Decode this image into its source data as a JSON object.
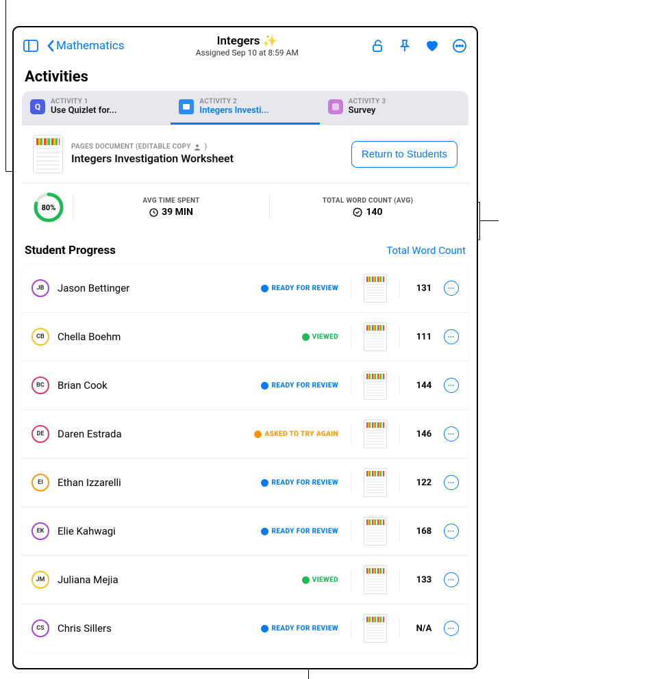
{
  "nav": {
    "back_label": "Mathematics",
    "title": "Integers ✨",
    "subtitle": "Assigned Sep 10 at 8:59 AM"
  },
  "section_title": "Activities",
  "tabs": [
    {
      "eyebrow": "ACTIVITY 1",
      "label": "Use Quizlet for..."
    },
    {
      "eyebrow": "ACTIVITY 2",
      "label": "Integers Investi..."
    },
    {
      "eyebrow": "ACTIVITY 3",
      "label": "Survey"
    }
  ],
  "doc": {
    "eyebrow": "PAGES DOCUMENT (EDITABLE COPY",
    "title": "Integers Investigation Worksheet",
    "return_label": "Return to Students"
  },
  "stats": {
    "percent": "80%",
    "percent_num": 80,
    "time_label": "AVG TIME SPENT",
    "time_value": "39 MIN",
    "words_label": "TOTAL WORD COUNT (AVG)",
    "words_value": "140"
  },
  "progress": {
    "title": "Student Progress",
    "link": "Total Word Count"
  },
  "status_labels": {
    "ready": "READY FOR REVIEW",
    "viewed": "VIEWED",
    "retry": "ASKED TO TRY AGAIN"
  },
  "students": [
    {
      "initials": "JB",
      "ring": "#a742d6",
      "name": "Jason Bettinger",
      "status": "ready",
      "count": "131"
    },
    {
      "initials": "CB",
      "ring": "#f5c518",
      "name": "Chella Boehm",
      "status": "viewed",
      "count": "111"
    },
    {
      "initials": "BC",
      "ring": "#e0395f",
      "name": "Brian Cook",
      "status": "ready",
      "count": "144"
    },
    {
      "initials": "DE",
      "ring": "#e0395f",
      "name": "Daren Estrada",
      "status": "retry",
      "count": "146"
    },
    {
      "initials": "EI",
      "ring": "#ff9500",
      "name": "Ethan Izzarelli",
      "status": "ready",
      "count": "122"
    },
    {
      "initials": "EK",
      "ring": "#a742d6",
      "name": "Elie Kahwagi",
      "status": "ready",
      "count": "168"
    },
    {
      "initials": "JM",
      "ring": "#f5c518",
      "name": "Juliana Mejia",
      "status": "viewed",
      "count": "133"
    },
    {
      "initials": "CS",
      "ring": "#a742d6",
      "name": "Chris Sillers",
      "status": "ready",
      "count": "N/A"
    }
  ]
}
